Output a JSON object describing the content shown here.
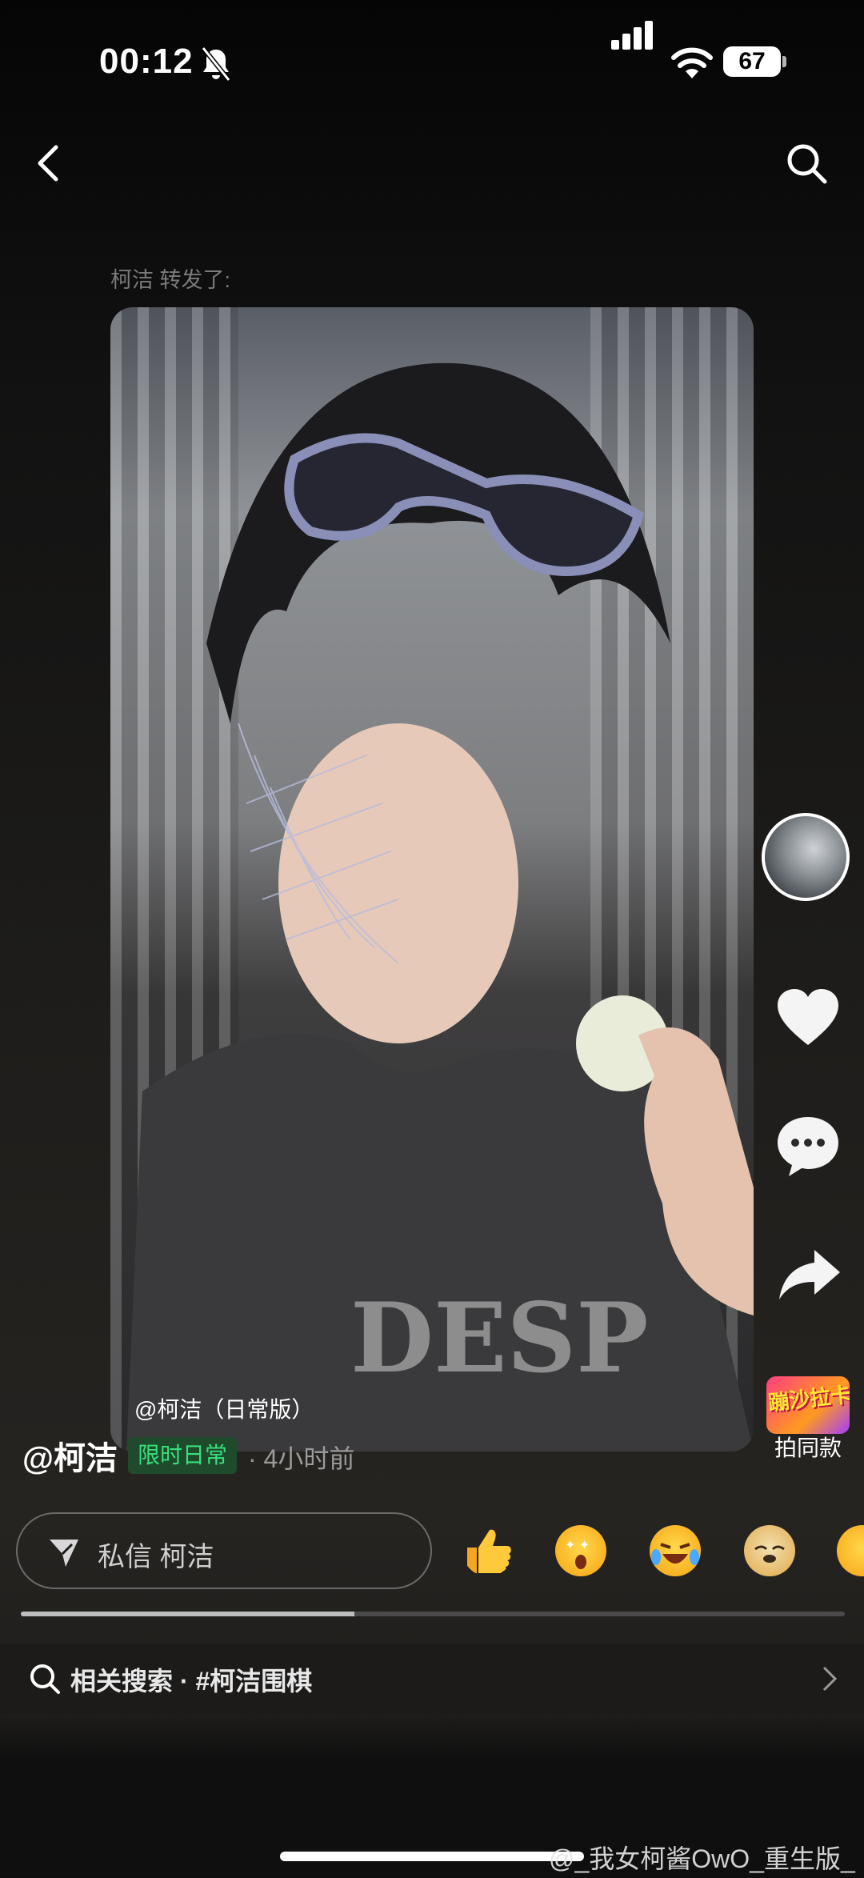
{
  "status_bar": {
    "time": "00:12",
    "battery": "67"
  },
  "repost_label": "柯洁 转发了:",
  "video": {
    "caption": "@柯洁（日常版）"
  },
  "side_actions": {
    "same_style_label": "拍同款",
    "same_style_thumb_text": "蹦沙拉卡"
  },
  "author": {
    "name": "@柯洁",
    "tag": "限时日常",
    "time_ago": "· 4小时前"
  },
  "message": {
    "placeholder": "私信 柯洁"
  },
  "emojis": [
    "thumbs-up",
    "star-eyes",
    "laughing-tears",
    "doge",
    "partial-emoji"
  ],
  "progress": {
    "fraction": 0.405
  },
  "related_search": {
    "label": "相关搜索 · #柯洁围棋"
  },
  "watermark": "@_我女柯酱OwO_重生版_"
}
